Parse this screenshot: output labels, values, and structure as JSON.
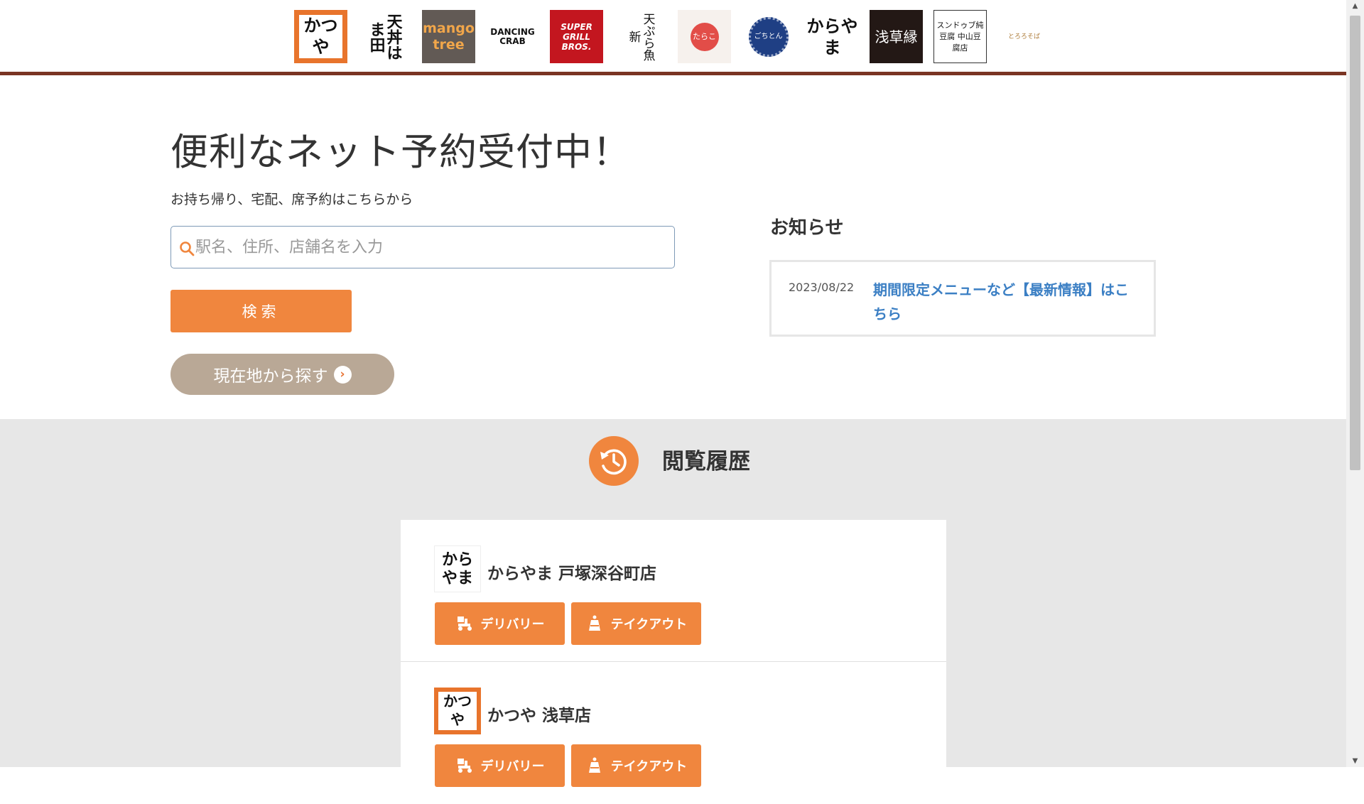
{
  "brands": [
    {
      "id": "katsuya",
      "text": "かつや"
    },
    {
      "id": "hamada",
      "text": "天丼はま田"
    },
    {
      "id": "mango",
      "text": "mango tree"
    },
    {
      "id": "crab",
      "text": "DANCING CRAB"
    },
    {
      "id": "super",
      "text": "SUPER GRILL BROS."
    },
    {
      "id": "uoshin",
      "text": "天ぷら魚新"
    },
    {
      "id": "tarako",
      "text": "たらこ"
    },
    {
      "id": "gochi",
      "text": "ごちとん"
    },
    {
      "id": "karayama",
      "text": "からやま"
    },
    {
      "id": "en",
      "text": "浅草縁"
    },
    {
      "id": "tofu",
      "text": "スンドゥブ純豆腐 中山豆腐店"
    },
    {
      "id": "toro",
      "text": "とろろそば"
    }
  ],
  "hero": {
    "title": "便利なネット予約受付中！",
    "subtitle": "お持ち帰り、宅配、席予約はこちらから",
    "search_placeholder": "駅名、住所、店舗名を入力",
    "search_button": "検索",
    "geo_button": "現在地から探す"
  },
  "news": {
    "title": "お知らせ",
    "items": [
      {
        "date": "2023/08/22",
        "text": "期間限定メニューなど【最新情報】はこちら"
      }
    ]
  },
  "history": {
    "title": "閲覧履歴",
    "shops": [
      {
        "name": "からやま 戸塚深谷町店",
        "logo": "からやま",
        "delivery_label": "デリバリー",
        "takeout_label": "テイクアウト"
      },
      {
        "name": "かつや 浅草店",
        "logo": "かつや",
        "delivery_label": "デリバリー",
        "takeout_label": "テイクアウト"
      }
    ]
  },
  "colors": {
    "accent": "#f0863e",
    "brand_bar": "#7a3423",
    "geo_button": "#b9a896",
    "link": "#3b7fc4"
  }
}
